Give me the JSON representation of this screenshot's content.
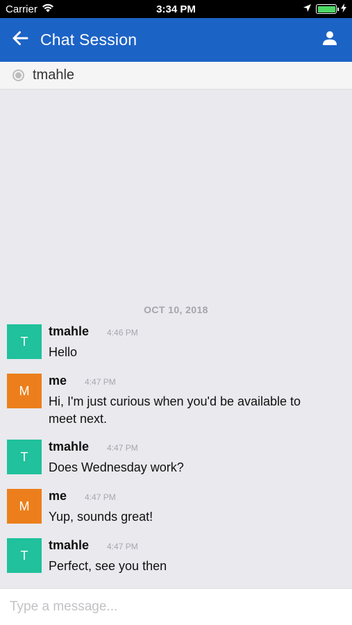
{
  "status_bar": {
    "carrier": "Carrier",
    "time": "3:34 PM",
    "battery_level": 1.0,
    "battery_color": "#4cd964"
  },
  "header": {
    "back_icon": "arrow-left-icon",
    "title": "Chat Session",
    "user_icon": "person-icon",
    "background": "#1c63c6"
  },
  "contact": {
    "presence_icon": "presence-offline-icon",
    "name": "tmahle"
  },
  "conversation": {
    "date": "OCT 10, 2018",
    "messages": [
      {
        "avatar_letter": "T",
        "avatar_color": "#20c19c",
        "sender": "tmahle",
        "time": "4:46 PM",
        "text": "Hello"
      },
      {
        "avatar_letter": "M",
        "avatar_color": "#ec7f1c",
        "sender": "me",
        "time": "4:47 PM",
        "text": "Hi, I'm just curious when you'd be available to meet next."
      },
      {
        "avatar_letter": "T",
        "avatar_color": "#20c19c",
        "sender": "tmahle",
        "time": "4:47 PM",
        "text": "Does Wednesday work?"
      },
      {
        "avatar_letter": "M",
        "avatar_color": "#ec7f1c",
        "sender": "me",
        "time": "4:47 PM",
        "text": "Yup, sounds great!"
      },
      {
        "avatar_letter": "T",
        "avatar_color": "#20c19c",
        "sender": "tmahle",
        "time": "4:47 PM",
        "text": "Perfect, see you then"
      }
    ]
  },
  "composer": {
    "placeholder": "Type a message...",
    "value": ""
  }
}
